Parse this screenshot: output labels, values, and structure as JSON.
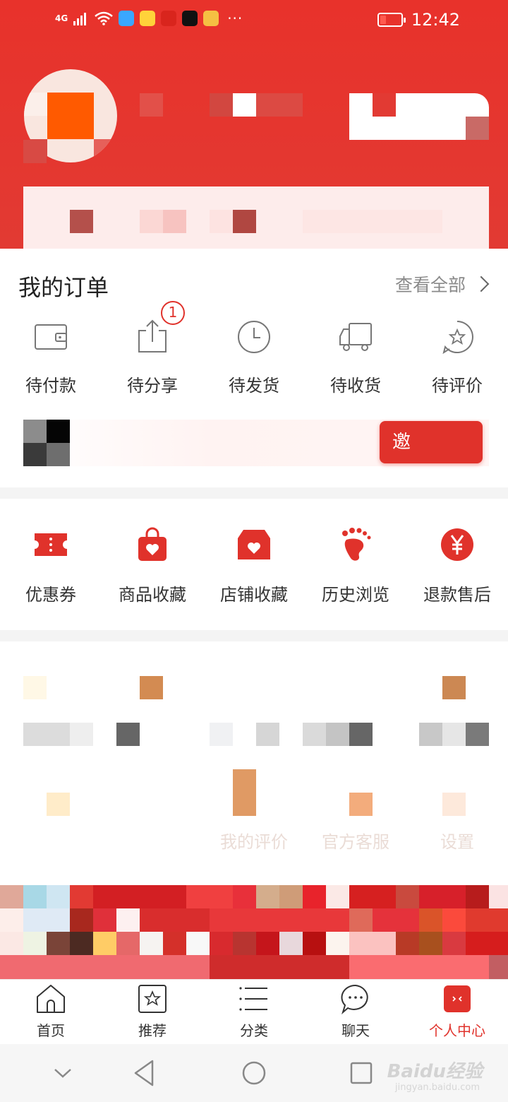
{
  "status_bar": {
    "network": "4G",
    "time": "12:42",
    "more": "···"
  },
  "orders": {
    "title": "我的订单",
    "view_all": "查看全部",
    "items": [
      {
        "label": "待付款",
        "icon": "wallet-icon"
      },
      {
        "label": "待分享",
        "icon": "share-icon",
        "badge": "1"
      },
      {
        "label": "待发货",
        "icon": "clock-icon"
      },
      {
        "label": "待收货",
        "icon": "truck-icon"
      },
      {
        "label": "待评价",
        "icon": "review-star-icon"
      }
    ],
    "promo_button": "邀"
  },
  "services": [
    {
      "label": "优惠券",
      "icon": "coupon-icon"
    },
    {
      "label": "商品收藏",
      "icon": "bag-heart-icon"
    },
    {
      "label": "店铺收藏",
      "icon": "store-heart-icon"
    },
    {
      "label": "历史浏览",
      "icon": "footprint-icon"
    },
    {
      "label": "退款售后",
      "icon": "yuan-refund-icon"
    }
  ],
  "tools": [
    {
      "label": "我的评价"
    },
    {
      "label": "官方客服"
    },
    {
      "label": "设置"
    }
  ],
  "tab_bar": [
    {
      "label": "首页",
      "icon": "home-icon"
    },
    {
      "label": "推荐",
      "icon": "recommend-icon"
    },
    {
      "label": "分类",
      "icon": "category-list-icon"
    },
    {
      "label": "聊天",
      "icon": "chat-icon"
    },
    {
      "label": "个人中心",
      "icon": "profile-icon",
      "active": true
    }
  ],
  "watermark": {
    "text": "Baidu经验",
    "sub": "jingyan.baidu.com"
  },
  "colors": {
    "brand_red": "#e0322b",
    "header_red": "#e8322b",
    "text_dark": "#333333",
    "text_gray": "#8a8a8a"
  }
}
